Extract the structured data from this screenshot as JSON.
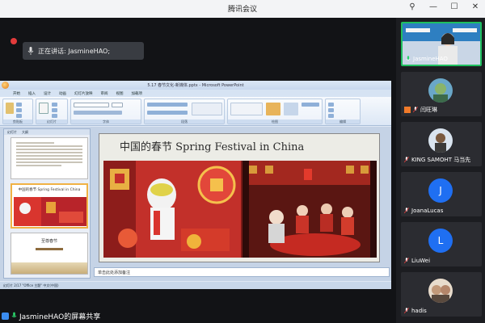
{
  "window": {
    "title": "腾讯会议",
    "controls": [
      "pin-icon",
      "minimize-icon",
      "maximize-icon",
      "close-icon"
    ]
  },
  "speaking": {
    "label": "正在讲话: JasmineHAO;"
  },
  "ppt": {
    "title": "5.17 春节文化-新媒体.pptx - Microsoft PowerPoint",
    "tabs": [
      "开始",
      "插入",
      "设计",
      "动画",
      "幻灯片放映",
      "审阅",
      "视图",
      "加载项"
    ],
    "ribbon_groups": [
      "剪贴板",
      "幻灯片",
      "字体",
      "段落",
      "绘图",
      "编辑"
    ],
    "side_tabs": [
      "幻灯片",
      "大纲"
    ],
    "thumbs": [
      {
        "num": "1",
        "caption": ""
      },
      {
        "num": "2",
        "caption": "中国的春节 Spring Festival in China"
      },
      {
        "num": "3",
        "caption": "至尊春节"
      }
    ],
    "slide_title": "中国的春节 Spring Festival in China",
    "notes": "单击此处添加备注",
    "status": "幻灯片 2/17    \"Office 主题\"    中文(中国)"
  },
  "share_banner": {
    "label": "JasmineHAO的屏幕共享"
  },
  "participants": [
    {
      "name": "JasmineHAO",
      "avatar": "video",
      "active": true
    },
    {
      "name": "闫旺琳",
      "avatar": "photo"
    },
    {
      "name": "KING SAMOHT 马当先",
      "avatar": "photo"
    },
    {
      "name": "JoanaLucas",
      "avatar": "letter",
      "letter": "J"
    },
    {
      "name": "LiuWei",
      "avatar": "letter",
      "letter": "L"
    },
    {
      "name": "hadis",
      "avatar": "photo"
    }
  ],
  "colors": {
    "accent": "#1fbf5f",
    "avatar_blue": "#1f6ff2",
    "record": "#e23b3b"
  }
}
